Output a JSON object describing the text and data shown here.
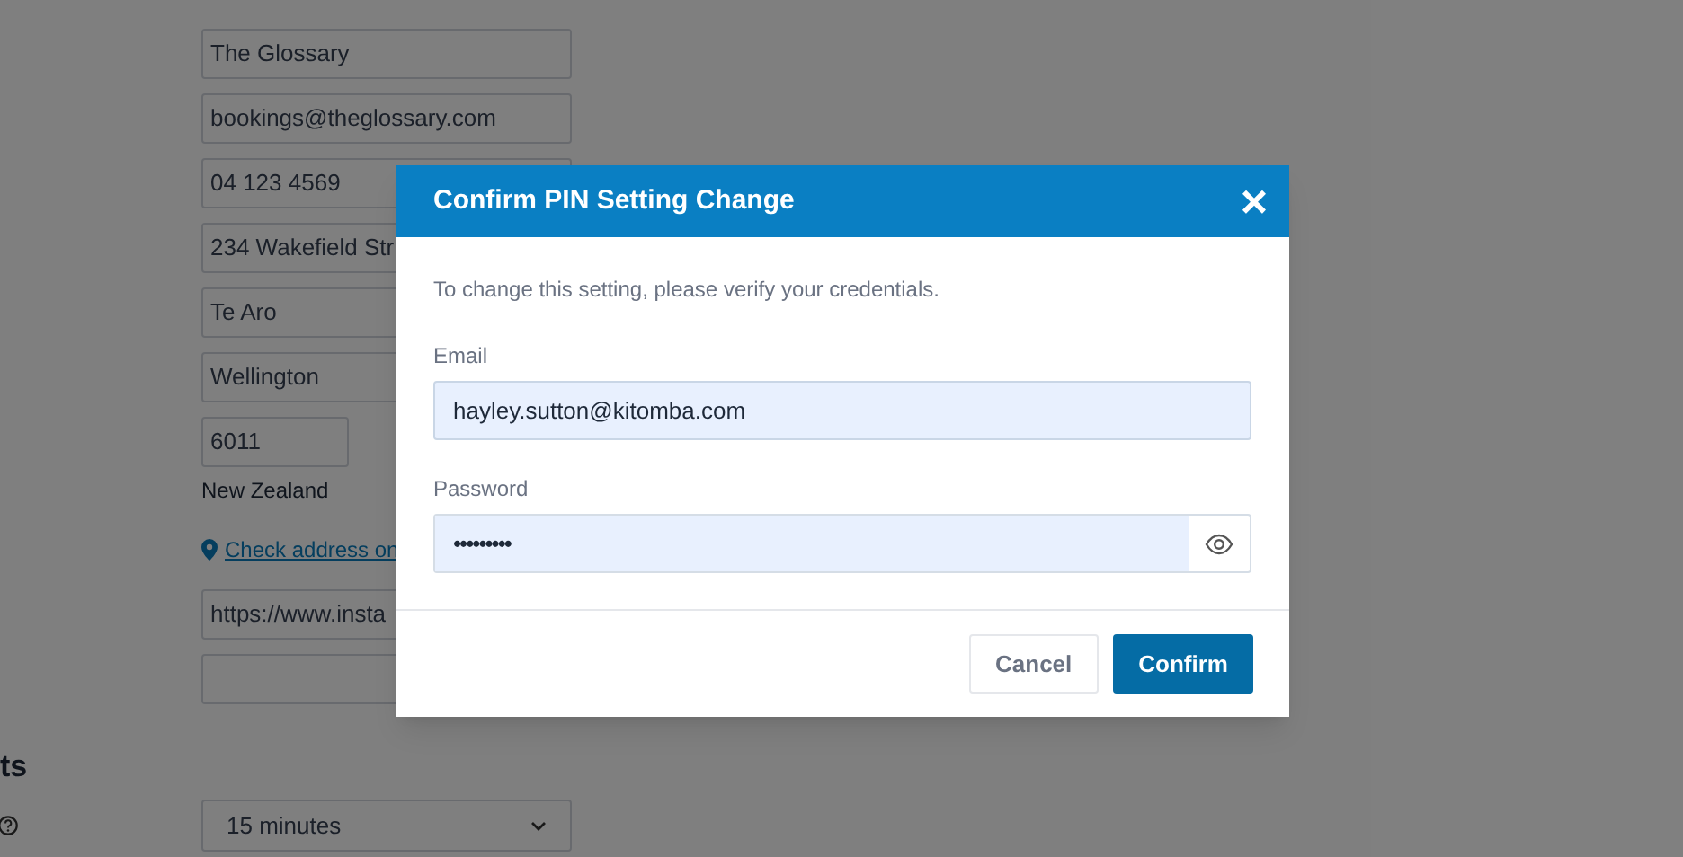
{
  "form": {
    "fields": [
      {
        "kind": "input",
        "value": "The Glossary"
      },
      {
        "kind": "input",
        "value": "bookings@theglossary.com"
      },
      {
        "kind": "input",
        "value": "04 123 4569"
      },
      {
        "kind": "input",
        "value": "234 Wakefield Str"
      },
      {
        "kind": "input",
        "value": "Te Aro"
      },
      {
        "kind": "input",
        "value": "Wellington"
      },
      {
        "kind": "short",
        "value": "6011"
      },
      {
        "kind": "text",
        "value": "New Zealand"
      },
      {
        "kind": "link",
        "value": "Check address on"
      },
      {
        "kind": "input",
        "value": "https://www.insta"
      },
      {
        "kind": "empty"
      }
    ],
    "section_heading": "ts",
    "select": {
      "value": "15 minutes"
    }
  },
  "dialog": {
    "title": "Confirm PIN Setting Change",
    "close": "×",
    "message": "To change this setting, please verify your credentials.",
    "email": {
      "label": "Email",
      "value": "hayley.sutton@kitomba.com"
    },
    "password": {
      "label": "Password",
      "value": "•••••••••"
    },
    "buttons": [
      {
        "kind": "secondary",
        "label": "Cancel"
      },
      {
        "kind": "primary",
        "label": "Confirm"
      }
    ]
  }
}
